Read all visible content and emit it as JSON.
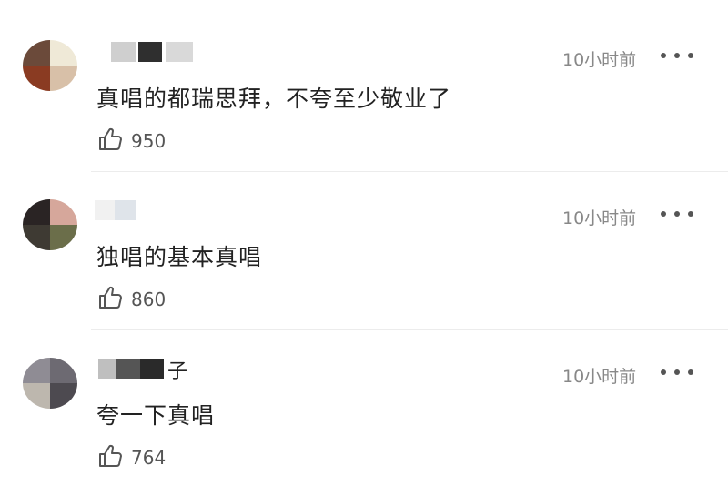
{
  "comments": [
    {
      "username": "",
      "time": "10小时前",
      "text": "真唱的都瑞思拜，不夸至少敬业了",
      "likes": "950"
    },
    {
      "username": "",
      "time": "10小时前",
      "text": "独唱的基本真唱",
      "likes": "860"
    },
    {
      "username": "子",
      "time": "10小时前",
      "text": "夸一下真唱",
      "likes": "764"
    }
  ],
  "colors": {
    "text": "#222222",
    "secondary": "#888888",
    "divider": "#ececec"
  },
  "icons": [
    "like-icon",
    "more-icon"
  ]
}
